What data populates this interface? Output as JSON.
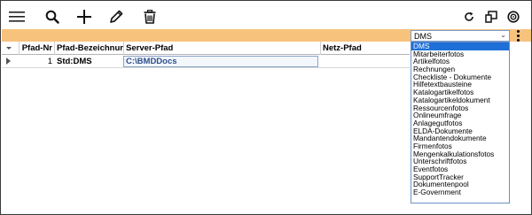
{
  "toolbar": {
    "menu_icon": "hamburger-menu-icon",
    "search_icon": "search-icon",
    "add_icon": "plus-icon",
    "edit_icon": "pencil-icon",
    "delete_icon": "trash-icon",
    "refresh_icon": "refresh-icon",
    "window_icon": "window-layout-icon",
    "help_icon": "help-circle-icon"
  },
  "colors": {
    "accent_bar": "#f7c27c",
    "selection": "#1e6fd8",
    "link_text": "#2d4f8b"
  },
  "dms_select": {
    "value": "DMS",
    "chevron": "⌄"
  },
  "grid": {
    "columns": [
      "Pfad-Nr",
      "Pfad-Bezeichnung",
      "Server-Pfad",
      "Netz-Pfad"
    ],
    "rows": [
      {
        "pfad_nr": "1",
        "bezeichnung": "Std:DMS",
        "server_pfad": "C:\\BMDDocs",
        "netz_pfad": ""
      }
    ]
  },
  "dropdown": {
    "selected": "DMS",
    "items": [
      "DMS",
      "Mitarbeiterfotos",
      "Artikelfotos",
      "Rechnungen",
      "Checkliste - Dokumente",
      "Hilfetextbausteine",
      "Katalogartikelfotos",
      "Katalogartikeldokument",
      "Ressourcenfotos",
      "Onlineumfrage",
      "Anlagegutfotos",
      "ELDA-Dokumente",
      "Mandantendokumente",
      "Firmenfotos",
      "Mengenkalkulationsfotos",
      "Unterschriftfotos",
      "Eventfotos",
      "SupportTracker",
      "Dokumentenpool",
      "E-Government"
    ]
  }
}
